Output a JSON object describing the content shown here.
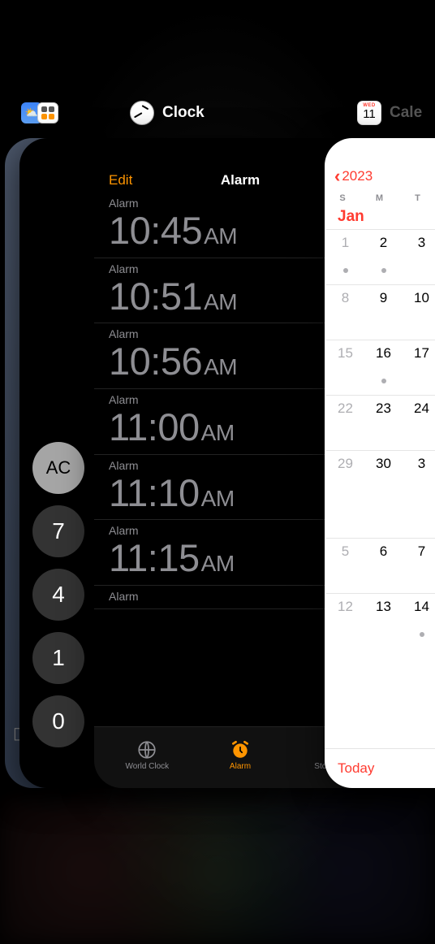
{
  "switcher": {
    "apps": {
      "calculator": {
        "label": "",
        "buttons": [
          "AC",
          "7",
          "4",
          "1",
          "0"
        ]
      },
      "clock": {
        "label": "Clock",
        "nav": {
          "edit": "Edit",
          "title": "Alarm"
        },
        "alarms": [
          {
            "label": "Alarm",
            "time": "10:45",
            "ampm": "AM"
          },
          {
            "label": "Alarm",
            "time": "10:51",
            "ampm": "AM"
          },
          {
            "label": "Alarm",
            "time": "10:56",
            "ampm": "AM"
          },
          {
            "label": "Alarm",
            "time": "11:00",
            "ampm": "AM"
          },
          {
            "label": "Alarm",
            "time": "11:10",
            "ampm": "AM"
          },
          {
            "label": "Alarm",
            "time": "11:15",
            "ampm": "AM"
          },
          {
            "label": "Alarm",
            "time": "",
            "ampm": ""
          }
        ],
        "tabs": {
          "world": "World Clock",
          "alarm": "Alarm",
          "stopwatch": "Stopwatch"
        }
      },
      "calendar": {
        "label": "Cale",
        "icon": {
          "dow": "WED",
          "day": "11"
        },
        "back": "2023",
        "dow": [
          "S",
          "M",
          "T"
        ],
        "month1": {
          "label": "Jan",
          "rows": [
            [
              {
                "d": "1",
                "muted": true,
                "dot": true
              },
              {
                "d": "2",
                "dot": true
              },
              {
                "d": "3"
              }
            ],
            [
              {
                "d": "8",
                "muted": true
              },
              {
                "d": "9"
              },
              {
                "d": "10"
              }
            ],
            [
              {
                "d": "15",
                "muted": true
              },
              {
                "d": "16",
                "dot": true
              },
              {
                "d": "17"
              }
            ],
            [
              {
                "d": "22",
                "muted": true
              },
              {
                "d": "23"
              },
              {
                "d": "24"
              }
            ],
            [
              {
                "d": "29",
                "muted": true
              },
              {
                "d": "30"
              },
              {
                "d": "3"
              }
            ]
          ]
        },
        "month2": {
          "rows": [
            [
              {
                "d": "5",
                "muted": true
              },
              {
                "d": "6"
              },
              {
                "d": "7"
              }
            ],
            [
              {
                "d": "12",
                "muted": true
              },
              {
                "d": "13"
              },
              {
                "d": "14",
                "dot": true
              }
            ]
          ]
        },
        "today": "Today"
      }
    }
  }
}
